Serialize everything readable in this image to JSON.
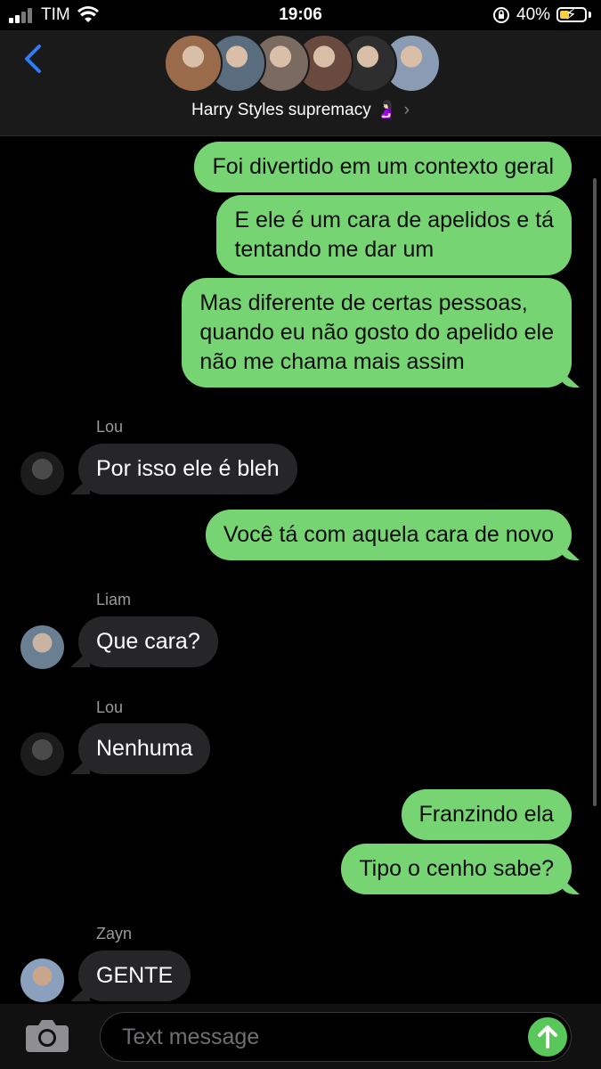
{
  "status_bar": {
    "carrier": "TIM",
    "time": "19:06",
    "battery_percent": "40%",
    "battery_level": 0.4,
    "battery_color": "#f4d03f"
  },
  "header": {
    "group_name": "Harry Styles supremacy 🤰🏻",
    "chevron": "›",
    "back_icon": "chevron-left-icon",
    "avatar_colors": [
      "#9a6b4b",
      "#5a6d7e",
      "#7b6a60",
      "#6a4a3e",
      "#2e2e2e",
      "#8a9cb4"
    ]
  },
  "messages": [
    {
      "direction": "out",
      "text": "Foi divertido em um contexto geral"
    },
    {
      "direction": "out",
      "lines": [
        "E ele é um cara de apelidos e  tá",
        "tentando me dar um"
      ]
    },
    {
      "direction": "out",
      "lines": [
        "Mas diferente de certas pessoas,",
        "quando eu não gosto do apelido ele",
        "não me chama mais assim"
      ]
    },
    {
      "direction": "in",
      "sender": "Lou",
      "text": "Por isso ele é bleh"
    },
    {
      "direction": "out",
      "text": "Você tá com aquela cara de novo"
    },
    {
      "direction": "in",
      "sender": "Liam",
      "text": "Que cara?"
    },
    {
      "direction": "in",
      "sender": "Lou",
      "text": "Nenhuma"
    },
    {
      "direction": "out",
      "text": "Franzindo ela"
    },
    {
      "direction": "out",
      "text": "Tipo o cenho sabe?"
    },
    {
      "direction": "in",
      "sender": "Zayn",
      "text": "GENTE"
    }
  ],
  "input": {
    "placeholder": "Text message",
    "camera_icon": "camera-icon",
    "send_icon": "arrow-up-icon"
  },
  "colors": {
    "outgoing_bubble": "#76d572",
    "incoming_bubble": "#262628",
    "accent_blue": "#2f7cf6"
  }
}
